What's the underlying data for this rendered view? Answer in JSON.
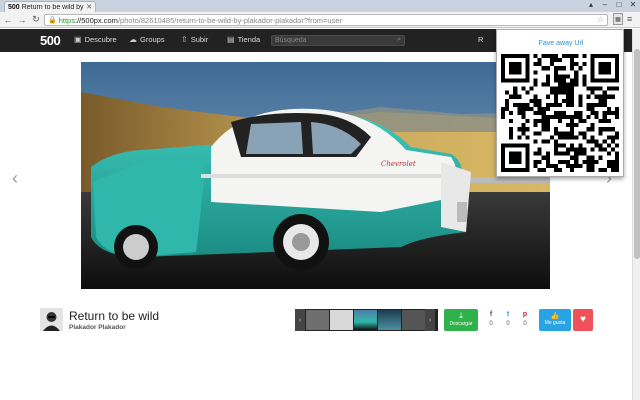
{
  "browser": {
    "tab_title": "Return to be wild by Pla...",
    "tab_favicon": "500",
    "url_https": "https",
    "url_host": "://500px.com",
    "url_path": "/photo/82610485/return-to-be-wild-by-plakador-plakador?from=user",
    "back_icon": "arrow-left-icon",
    "forward_icon": "arrow-right-icon",
    "reload_icon": "reload-icon"
  },
  "site": {
    "logo": "500",
    "nav": [
      {
        "label": "Descubre",
        "icon": "compass-icon"
      },
      {
        "label": "Groups",
        "icon": "groups-icon"
      },
      {
        "label": "Subir",
        "icon": "upload-icon"
      },
      {
        "label": "Tienda",
        "icon": "store-icon"
      }
    ],
    "search_placeholder": "Búsqueda",
    "header_right": "R"
  },
  "qr_popup": {
    "title": "Fave away Url"
  },
  "photo": {
    "title": "Return to be wild",
    "author": "Plakador Plakador"
  },
  "actions": {
    "download": "Descargar",
    "facebook_count": "0",
    "twitter_count": "0",
    "pinterest_count": "0",
    "like": "Me gusta"
  },
  "colors": {
    "header_bg": "#222222",
    "download_green": "#2fb24b",
    "like_blue": "#29a3e3",
    "fav_red": "#f0505a"
  }
}
